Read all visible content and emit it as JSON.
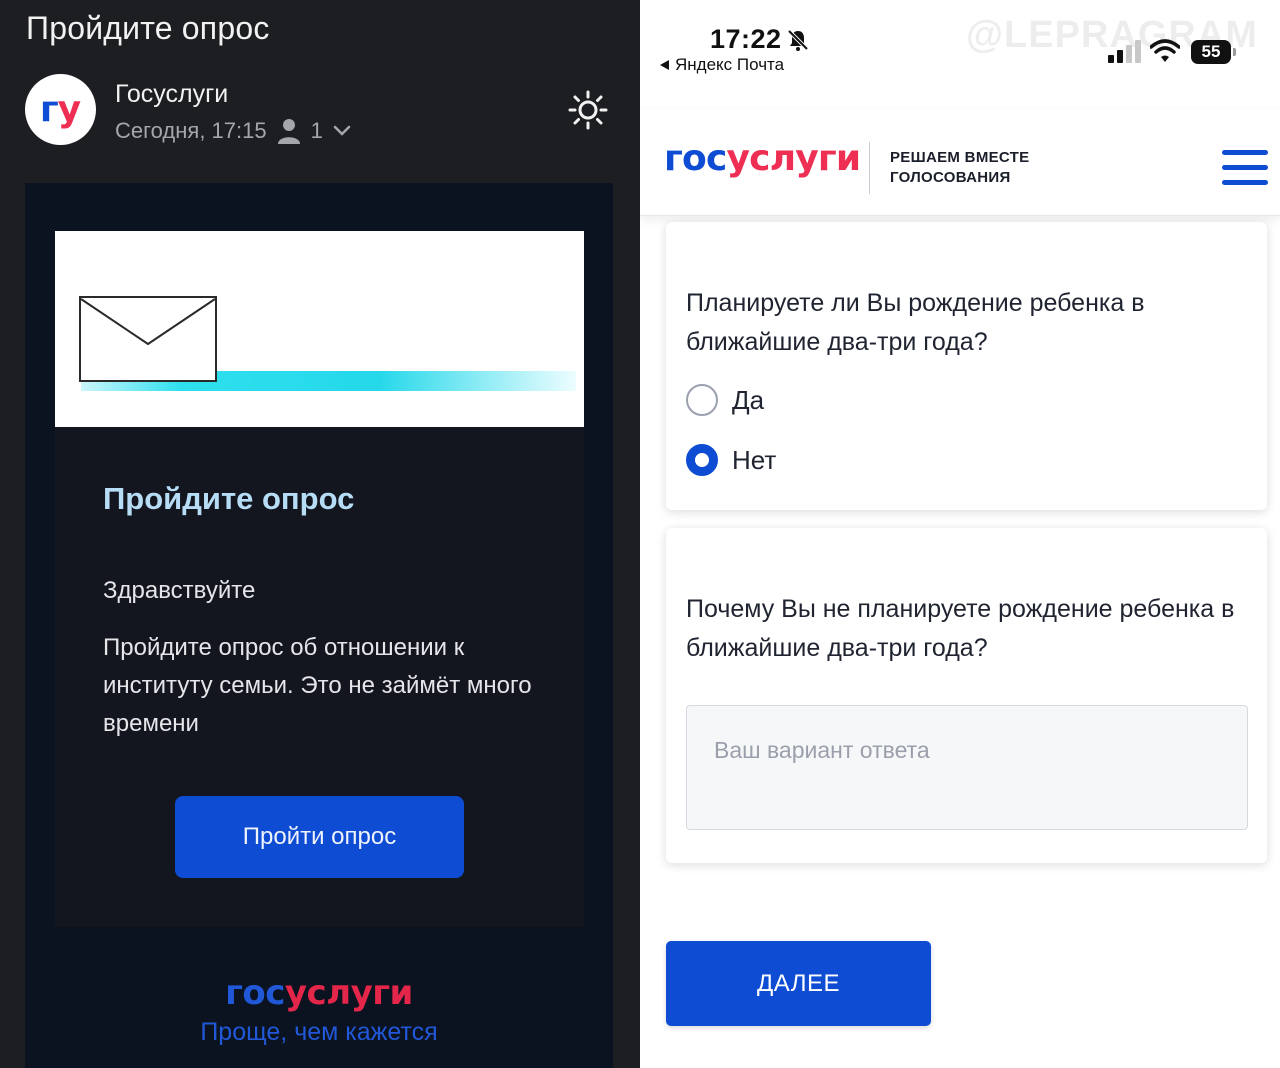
{
  "left_panel": {
    "subject": "Пройдите опрос",
    "sender": {
      "avatar_text_1": "г",
      "avatar_text_2": "у",
      "name": "Госуслуги",
      "date": "Сегодня, 17:15",
      "recipients_count": "1"
    },
    "icons": {
      "theme": "sun-icon",
      "recipients": "person-icon",
      "expand": "chevron-down-icon",
      "banner": "envelope-icon"
    },
    "email": {
      "title": "Пройдите опрос",
      "greeting": "Здравствуйте",
      "body": "Пройдите опрос об отношении к институту семьи. Это не займёт много времени",
      "button_label": "Пройти опрос",
      "footer_logo_part1": "гос",
      "footer_logo_part2": "услуги",
      "footer_tagline": "Проще, чем кажется"
    },
    "colors": {
      "background": "#1d1e22",
      "button": "#0d4cd3",
      "title": "#b6ddf5"
    }
  },
  "right_panel": {
    "status_bar": {
      "time": "17:22",
      "back_app": "Яндекс Почта",
      "battery": "55",
      "watermark": "@LEPRAGRAM"
    },
    "header": {
      "logo_part1": "гос",
      "logo_part2": "услуги",
      "slogan_line1": "РЕШАЕМ ВМЕСТЕ",
      "slogan_line2": "ГОЛОСОВАНИЯ"
    },
    "question1": {
      "text": "Планируете ли Вы рождение ребенка в ближайшие два-три года?",
      "options": [
        {
          "label": "Да",
          "selected": false
        },
        {
          "label": "Нет",
          "selected": true
        }
      ]
    },
    "question2": {
      "text": "Почему Вы не планируете рождение ребенка в ближайшие два-три года?",
      "placeholder": "Ваш вариант ответа"
    },
    "next_button": "ДАЛЕЕ",
    "colors": {
      "brand_blue": "#0d4cd3",
      "brand_red": "#ee2f53"
    }
  }
}
